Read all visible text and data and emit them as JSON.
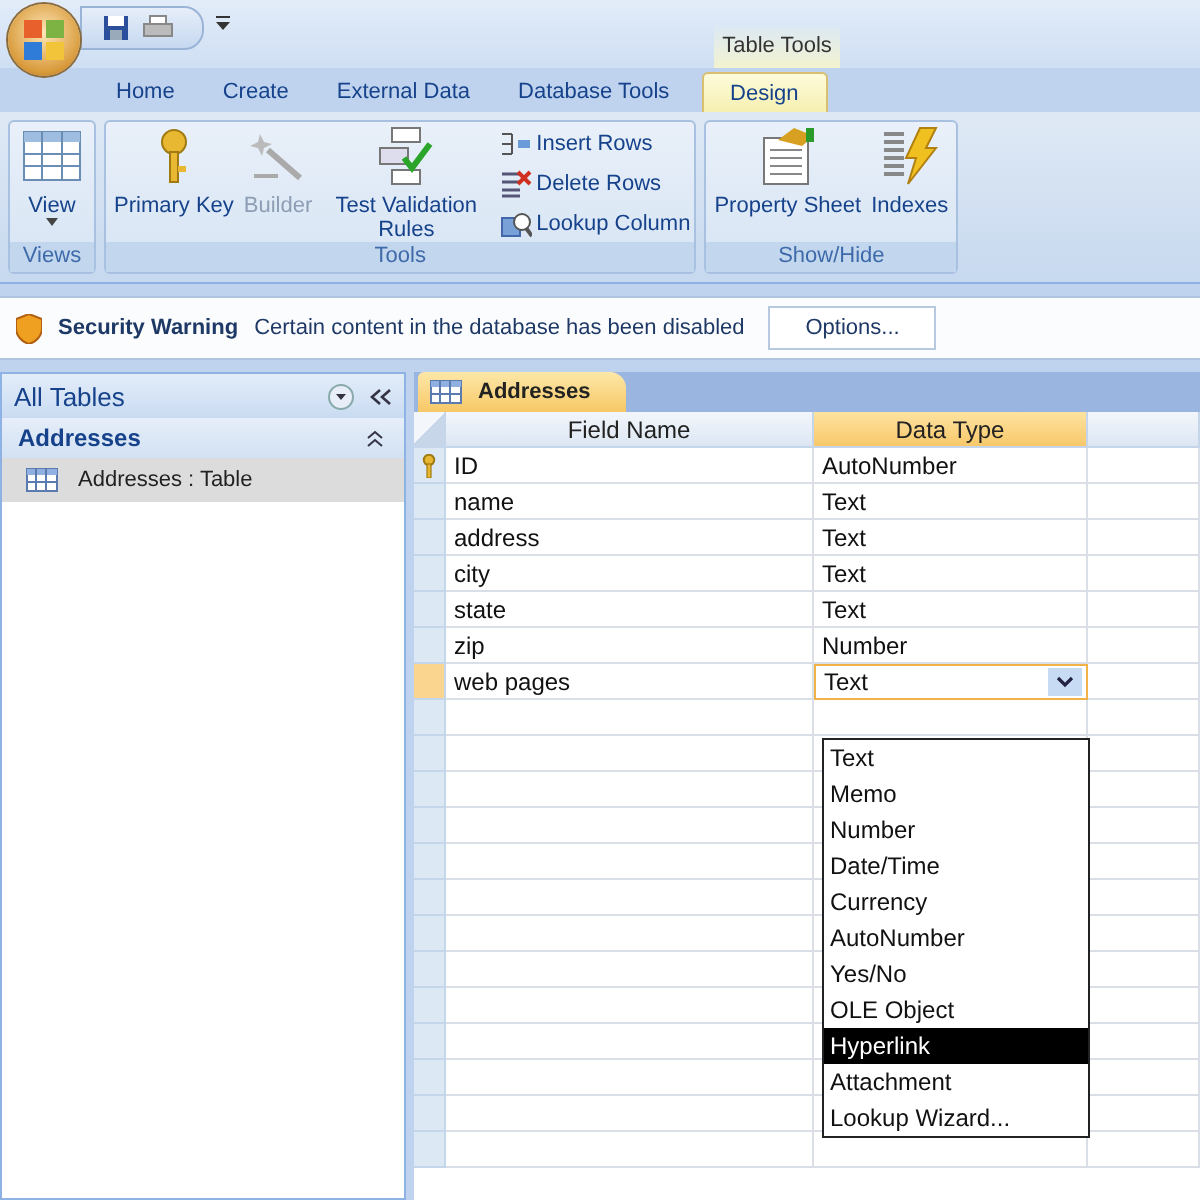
{
  "contextual_tab_group": "Table Tools",
  "tabs": [
    {
      "label": "Home",
      "selected": false
    },
    {
      "label": "Create",
      "selected": false
    },
    {
      "label": "External Data",
      "selected": false
    },
    {
      "label": "Database Tools",
      "selected": false
    },
    {
      "label": "Design",
      "selected": true
    }
  ],
  "ribbon_groups": [
    {
      "title": "Views",
      "buttons": [
        {
          "kind": "large",
          "label": "View",
          "dropdown": true,
          "disabled": false
        }
      ]
    },
    {
      "title": "Tools",
      "buttons": [
        {
          "kind": "large",
          "label": "Primary Key",
          "disabled": false
        },
        {
          "kind": "large",
          "label": "Builder",
          "disabled": true
        },
        {
          "kind": "large",
          "label": "Test Validation Rules",
          "disabled": false
        },
        {
          "kind": "small",
          "label": "Insert Rows",
          "disabled": false
        },
        {
          "kind": "small",
          "label": "Delete Rows",
          "disabled": false
        },
        {
          "kind": "small",
          "label": "Lookup Column",
          "disabled": false
        }
      ]
    },
    {
      "title": "Show/Hide",
      "buttons": [
        {
          "kind": "large",
          "label": "Property Sheet",
          "disabled": false
        },
        {
          "kind": "large",
          "label": "Indexes",
          "disabled": false
        }
      ]
    }
  ],
  "security_bar": {
    "title": "Security Warning",
    "message": "Certain content in the database has been disabled",
    "button": "Options..."
  },
  "nav_pane": {
    "title": "All Tables",
    "groups": [
      {
        "label": "Addresses",
        "expanded": true,
        "items": [
          {
            "label": "Addresses : Table",
            "selected": true
          }
        ]
      }
    ]
  },
  "document_tab": {
    "label": "Addresses",
    "selected": true
  },
  "grid": {
    "columns": [
      "Field Name",
      "Data Type"
    ],
    "rows": [
      {
        "field": "ID",
        "type": "AutoNumber",
        "primary_key": true,
        "selected": false
      },
      {
        "field": "name",
        "type": "Text",
        "primary_key": false,
        "selected": false
      },
      {
        "field": "address",
        "type": "Text",
        "primary_key": false,
        "selected": false
      },
      {
        "field": "city",
        "type": "Text",
        "primary_key": false,
        "selected": false
      },
      {
        "field": "state",
        "type": "Text",
        "primary_key": false,
        "selected": false
      },
      {
        "field": "zip",
        "type": "Number",
        "primary_key": false,
        "selected": false
      },
      {
        "field": "web pages",
        "type": "Text",
        "primary_key": false,
        "selected": true
      }
    ],
    "dropdown": {
      "options": [
        {
          "label": "Text",
          "selected": false
        },
        {
          "label": "Memo",
          "selected": false
        },
        {
          "label": "Number",
          "selected": false
        },
        {
          "label": "Date/Time",
          "selected": false
        },
        {
          "label": "Currency",
          "selected": false
        },
        {
          "label": "AutoNumber",
          "selected": false
        },
        {
          "label": "Yes/No",
          "selected": false
        },
        {
          "label": "OLE Object",
          "selected": false
        },
        {
          "label": "Hyperlink",
          "selected": true
        },
        {
          "label": "Attachment",
          "selected": false
        },
        {
          "label": "Lookup Wizard...",
          "selected": false
        }
      ]
    }
  }
}
